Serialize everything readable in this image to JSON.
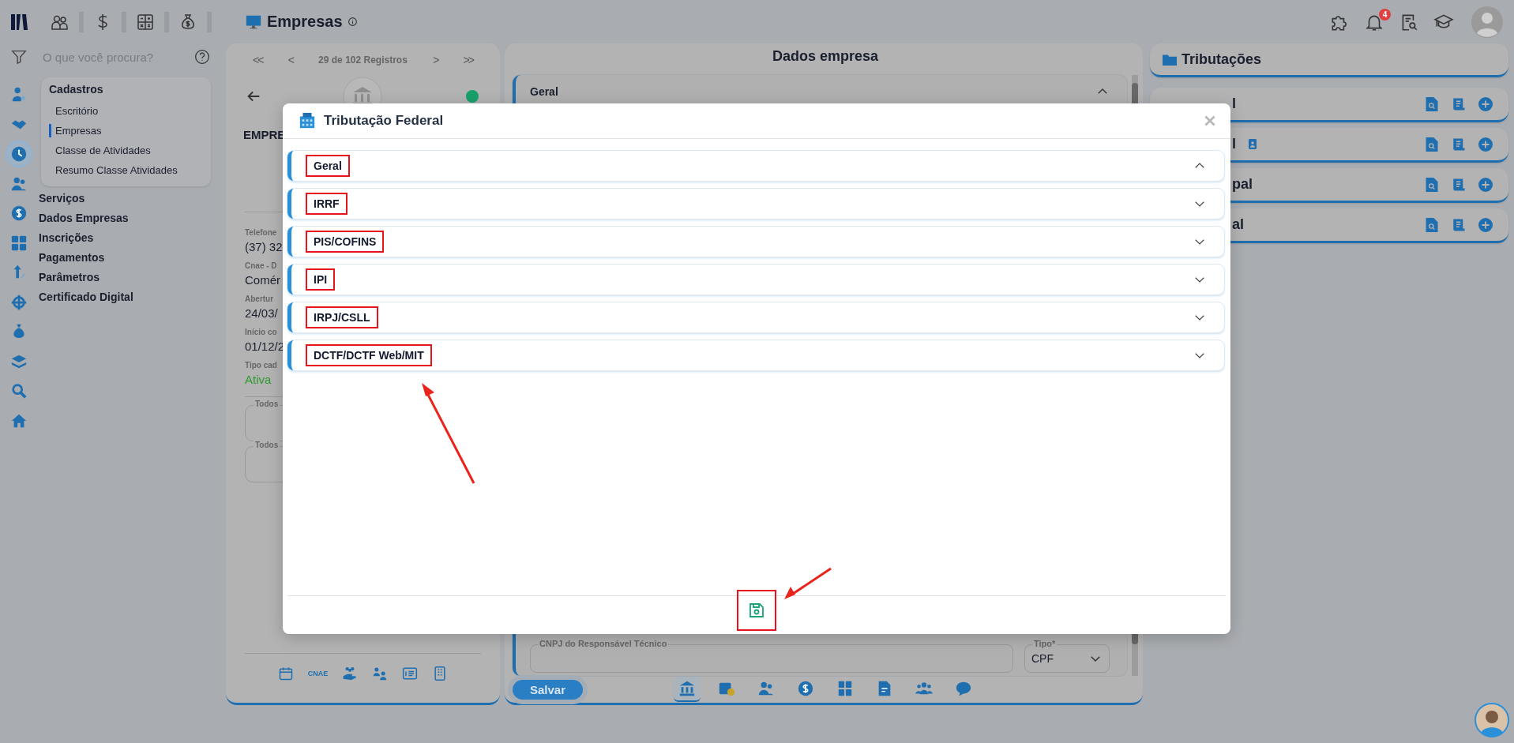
{
  "top_bar": {
    "page_title": "Empresas",
    "notification_count": "4"
  },
  "search": {
    "placeholder": "O que você procura?"
  },
  "rail_items": [
    {
      "selected": false
    },
    {
      "selected": false
    },
    {
      "selected": true
    },
    {
      "selected": false
    },
    {
      "selected": false
    },
    {
      "selected": false
    },
    {
      "selected": false
    },
    {
      "selected": false
    },
    {
      "selected": false
    },
    {
      "selected": false
    },
    {
      "selected": false
    },
    {
      "selected": false
    }
  ],
  "nav": {
    "group": {
      "title": "Cadastros",
      "items": [
        {
          "label": "Escritório",
          "selected": false
        },
        {
          "label": "Empresas",
          "selected": true
        },
        {
          "label": "Classe de Atividades",
          "selected": false
        },
        {
          "label": "Resumo Classe Atividades",
          "selected": false
        }
      ]
    },
    "items": [
      {
        "label": "Serviços"
      },
      {
        "label": "Dados Empresas"
      },
      {
        "label": "Inscrições"
      },
      {
        "label": "Pagamentos"
      },
      {
        "label": "Parâmetros"
      },
      {
        "label": "Certificado Digital"
      }
    ]
  },
  "left_panel": {
    "pager_buttons": [
      "<<",
      "<",
      ">",
      ">>"
    ],
    "pager": "29 de 102 Registros",
    "company_name": "EMPRE",
    "fields": [
      {
        "label": "Telefone",
        "value": "(37) 32",
        "kind": "text"
      },
      {
        "label": "Cnae - D",
        "value": "Comér",
        "kind": "text"
      },
      {
        "label": "Abertur",
        "value": "24/03/",
        "kind": "text"
      },
      {
        "label": "Início co",
        "value": "01/12/2",
        "kind": "text"
      },
      {
        "label": "Tipo cad",
        "value": "Ativa",
        "kind": "status"
      }
    ],
    "filters": [
      {
        "label": "Todos"
      },
      {
        "label": "Todos"
      }
    ],
    "toolbar_label": "CNAE"
  },
  "center_panel": {
    "title": "Dados empresa",
    "section": {
      "title": "Geral",
      "expanded": true
    },
    "cnpj_field": {
      "label": "CNPJ do Responsável Técnico"
    },
    "type_field": {
      "label": "Tipo*",
      "value": "CPF"
    },
    "save_button": "Salvar",
    "tabs": [
      {
        "selected": true
      },
      {
        "selected": false
      },
      {
        "selected": false
      },
      {
        "selected": false
      },
      {
        "selected": false
      },
      {
        "selected": false
      },
      {
        "selected": false
      },
      {
        "selected": false
      }
    ]
  },
  "right_panel": {
    "title": "Tributações",
    "cards": [
      {
        "title": "l",
        "has_badge": false
      },
      {
        "title": "l",
        "has_badge": true
      },
      {
        "title": "pal",
        "has_badge": false
      },
      {
        "title": "al",
        "has_badge": false
      }
    ]
  },
  "modal": {
    "title": "Tributação Federal",
    "sections": [
      {
        "label": "Geral",
        "expanded": true,
        "highlighted": true
      },
      {
        "label": "IRRF",
        "expanded": false,
        "highlighted": true
      },
      {
        "label": "PIS/COFINS",
        "expanded": false,
        "highlighted": true
      },
      {
        "label": "IPI",
        "expanded": false,
        "highlighted": true
      },
      {
        "label": "IRPJ/CSLL",
        "expanded": false,
        "highlighted": true
      },
      {
        "label": "DCTF/DCTF Web/MIT",
        "expanded": false,
        "highlighted": true
      }
    ],
    "save_highlighted": true
  }
}
